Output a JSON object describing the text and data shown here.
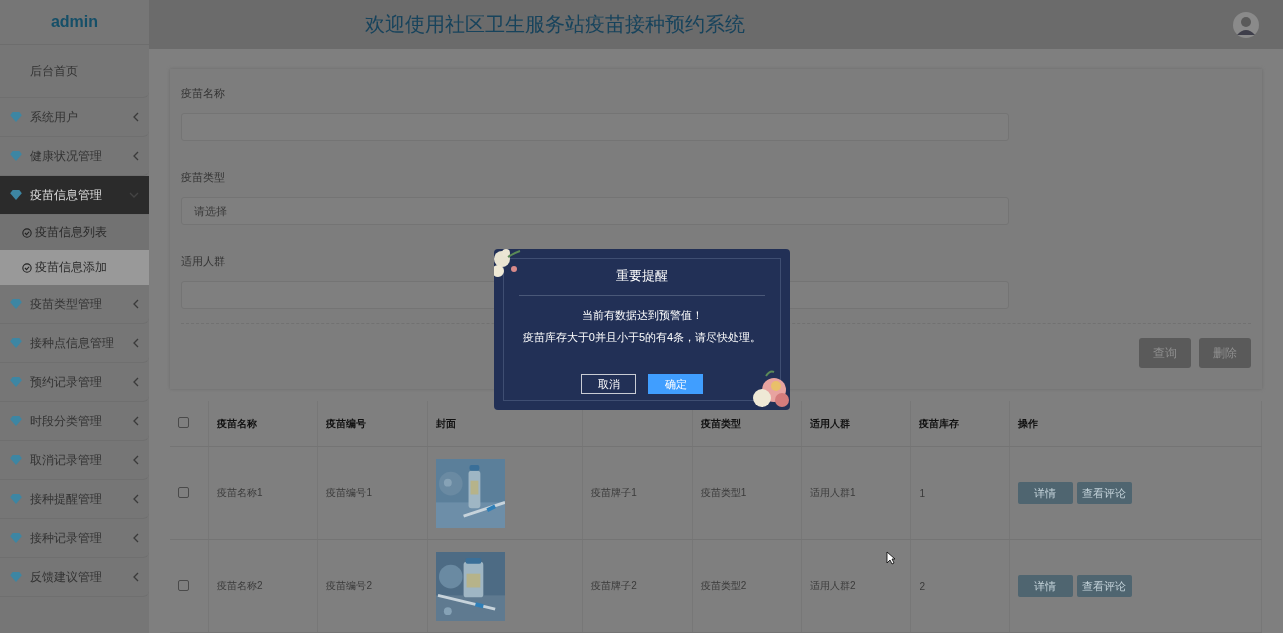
{
  "header": {
    "title": "欢迎使用社区卫生服务站疫苗接种预约系统"
  },
  "sidebar": {
    "title": "admin",
    "items": [
      {
        "label": "后台首页",
        "kind": "link"
      },
      {
        "label": "系统用户",
        "kind": "menu",
        "expanded": false
      },
      {
        "label": "健康状况管理",
        "kind": "menu",
        "expanded": false
      },
      {
        "label": "疫苗信息管理",
        "kind": "menu",
        "expanded": true,
        "children": [
          {
            "label": "疫苗信息列表",
            "selected": false
          },
          {
            "label": "疫苗信息添加",
            "selected": true
          }
        ]
      },
      {
        "label": "疫苗类型管理",
        "kind": "menu",
        "expanded": false
      },
      {
        "label": "接种点信息管理",
        "kind": "menu",
        "expanded": false
      },
      {
        "label": "预约记录管理",
        "kind": "menu",
        "expanded": false
      },
      {
        "label": "时段分类管理",
        "kind": "menu",
        "expanded": false
      },
      {
        "label": "取消记录管理",
        "kind": "menu",
        "expanded": false
      },
      {
        "label": "接种提醒管理",
        "kind": "menu",
        "expanded": false
      },
      {
        "label": "接种记录管理",
        "kind": "menu",
        "expanded": false
      },
      {
        "label": "反馈建议管理",
        "kind": "menu",
        "expanded": false
      }
    ]
  },
  "search": {
    "fields": [
      {
        "label": "疫苗名称",
        "kind": "input"
      },
      {
        "label": "疫苗类型",
        "kind": "select",
        "placeholder": "请选择"
      },
      {
        "label": "适用人群",
        "kind": "input"
      }
    ],
    "buttons": [
      "查询",
      "删除"
    ]
  },
  "table": {
    "all_checked": false,
    "columns": [
      "疫苗名称",
      "疫苗编号",
      "封面",
      null,
      "疫苗类型",
      "适用人群",
      "疫苗库存",
      "操作"
    ],
    "rows": [
      {
        "checked": false,
        "cells": [
          "疫苗名称1",
          "疫苗编号1",
          {
            "kind": "picture"
          },
          "疫苗牌子1",
          "疫苗类型1",
          "适用人群1",
          "1"
        ],
        "actions": [
          "详情",
          "查看评论"
        ]
      },
      {
        "checked": false,
        "cells": [
          "疫苗名称2",
          "疫苗编号2",
          {
            "kind": "picture"
          },
          "疫苗牌子2",
          "疫苗类型2",
          "适用人群2",
          "2"
        ],
        "actions": [
          "详情",
          "查看评论"
        ]
      }
    ]
  },
  "dialog": {
    "title": "重要提醒",
    "lines": [
      "当前有数据达到预警值！",
      "疫苗库存大于0并且小于5的有4条，请尽快处理。"
    ],
    "buttons": [
      {
        "label": "取消",
        "kind": "secondary"
      },
      {
        "label": "确定",
        "kind": "primary"
      }
    ]
  }
}
